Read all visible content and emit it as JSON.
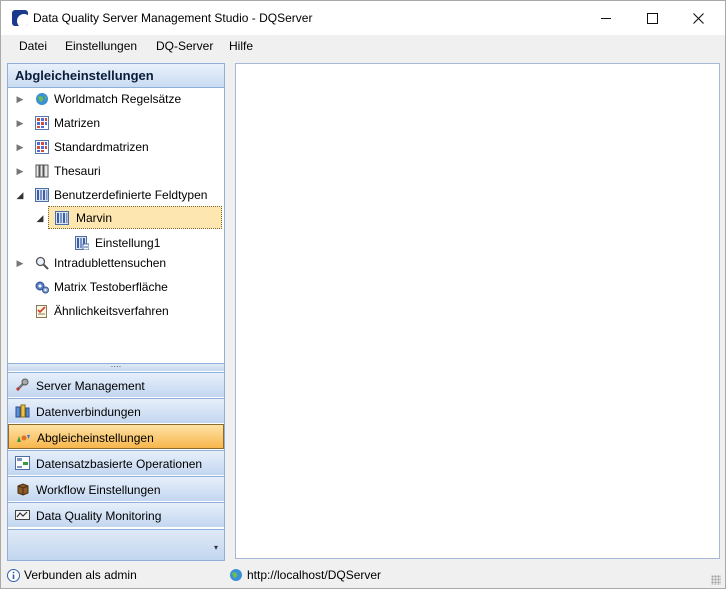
{
  "window": {
    "title": "Data Quality Server Management Studio - DQServer"
  },
  "menu": {
    "items": [
      "Datei",
      "Einstellungen",
      "DQ-Server",
      "Hilfe"
    ]
  },
  "left_panel": {
    "header": "Abgleicheinstellungen",
    "tree": [
      {
        "label": "Worldmatch Regelsätze",
        "icon": "globe-icon",
        "expander": "collapsed"
      },
      {
        "label": "Matrizen",
        "icon": "matrix-icon",
        "expander": "collapsed"
      },
      {
        "label": "Standardmatrizen",
        "icon": "matrix-icon",
        "expander": "collapsed"
      },
      {
        "label": "Thesauri",
        "icon": "book-icon",
        "expander": "collapsed"
      },
      {
        "label": "Benutzerdefinierte Feldtypen",
        "icon": "fieldtype-icon",
        "expander": "expanded"
      },
      {
        "label": "Marvin",
        "icon": "fieldtype-icon",
        "expander": "expanded",
        "selected": true
      },
      {
        "label": "Einstellung1",
        "icon": "setting-icon",
        "expander": "none"
      },
      {
        "label": "Intradublettensuchen",
        "icon": "magnifier-icon",
        "expander": "collapsed"
      },
      {
        "label": "Matrix Testoberfläche",
        "icon": "gears-icon",
        "expander": "none"
      },
      {
        "label": "Ähnlichkeitsverfahren",
        "icon": "checklist-icon",
        "expander": "none"
      }
    ],
    "splitter_grip": "····",
    "nav_buttons": [
      {
        "label": "Server Management",
        "icon": "wrench-icon"
      },
      {
        "label": "Datenverbindungen",
        "icon": "database-icon"
      },
      {
        "label": "Abgleicheinstellungen",
        "icon": "abgleich-icon",
        "active": true
      },
      {
        "label": "Datensatzbasierte Operationen",
        "icon": "records-icon"
      },
      {
        "label": "Workflow Einstellungen",
        "icon": "box-icon"
      },
      {
        "label": "Data Quality Monitoring",
        "icon": "monitor-icon"
      }
    ],
    "footer_arrow": "▾"
  },
  "status_bar": {
    "connection": "Verbunden als admin",
    "server_url": "http://localhost/DQServer"
  },
  "colors": {
    "nav_active_top": "#fde3a6",
    "nav_active_bottom": "#f8b64c",
    "panel_border": "#8fb0d9",
    "selected_row": "#fde6b0"
  }
}
